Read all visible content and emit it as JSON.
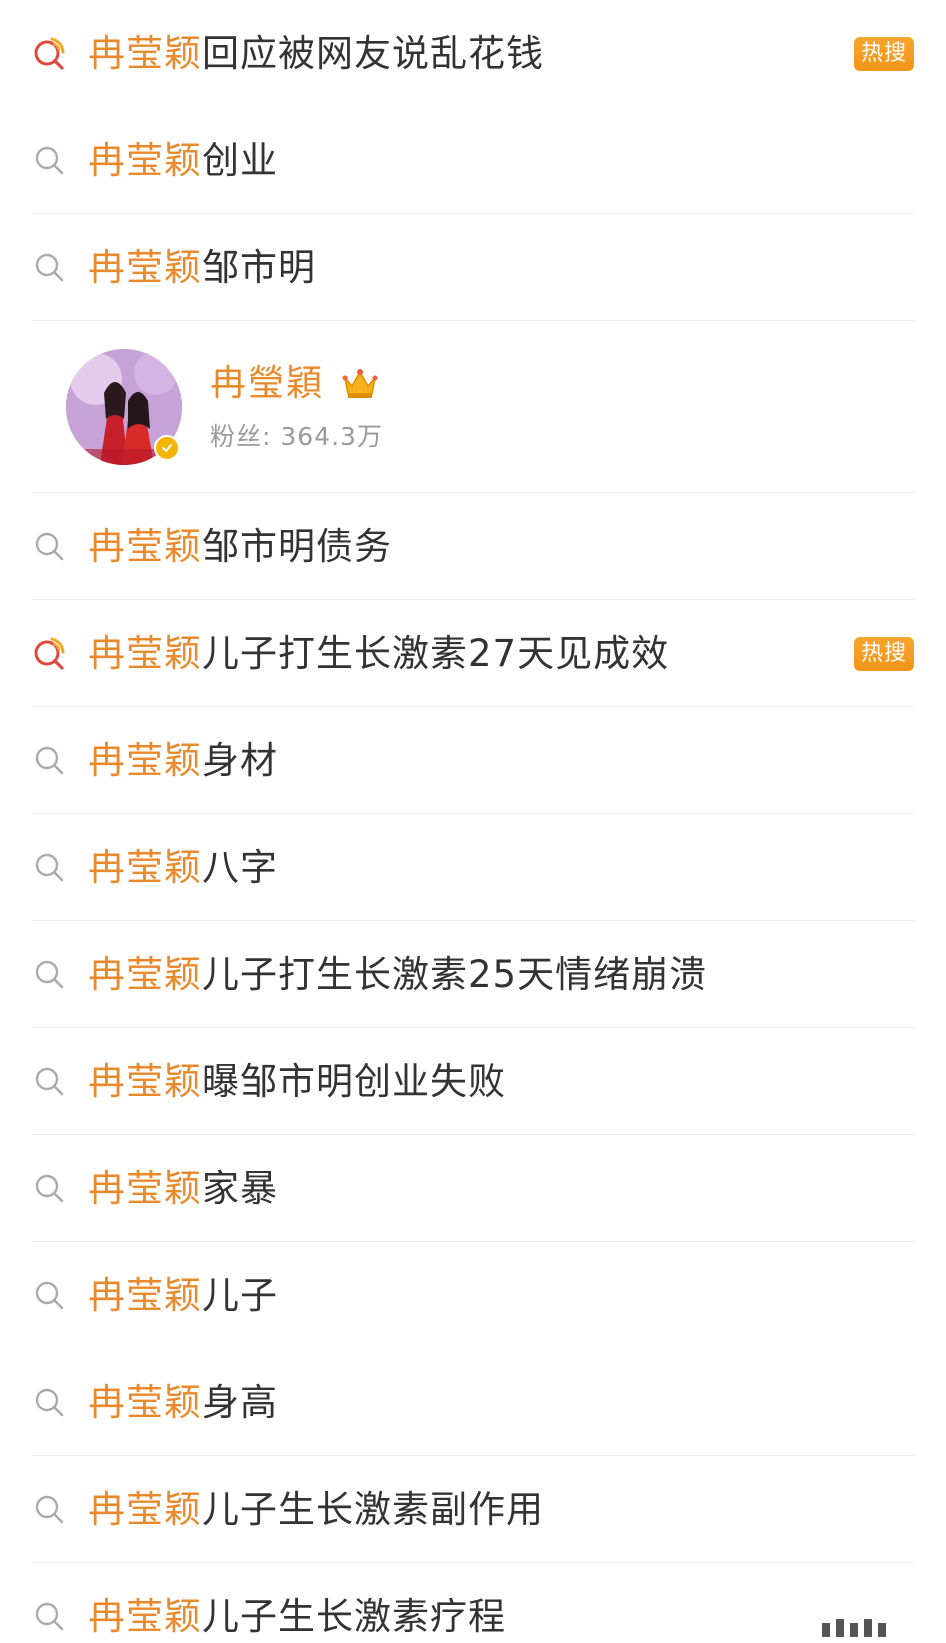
{
  "keyword": "冉莹颖",
  "hot_label": "热搜",
  "colors": {
    "keyword": "#e8892b",
    "text": "#333333",
    "hot_badge": "#f29417",
    "divider": "#ececec",
    "search_icon": "#aaaaaa",
    "hot_icon_red": "#e0483e",
    "hot_icon_orange": "#f5a623"
  },
  "rows_before_user": [
    {
      "kw": "冉莹颖",
      "rest": "回应被网友说乱花钱",
      "hot": true,
      "icon": "hot-search-icon"
    },
    {
      "kw": "冉莹颖",
      "rest": "创业",
      "hot": false,
      "icon": "search-icon"
    },
    {
      "kw": "冉莹颖",
      "rest": "邹市明",
      "hot": false,
      "icon": "search-icon"
    }
  ],
  "user": {
    "name": "冉瑩穎",
    "fans": "粉丝: 364.3万",
    "crown_icon": "crown-icon",
    "verified_icon": "verified-badge-icon"
  },
  "rows_after_user": [
    {
      "kw": "冉莹颖",
      "rest": "邹市明债务",
      "hot": false,
      "icon": "search-icon"
    },
    {
      "kw": "冉莹颖",
      "rest": "儿子打生长激素27天见成效",
      "hot": true,
      "icon": "hot-search-icon"
    },
    {
      "kw": "冉莹颖",
      "rest": "身材",
      "hot": false,
      "icon": "search-icon"
    },
    {
      "kw": "冉莹颖",
      "rest": "八字",
      "hot": false,
      "icon": "search-icon"
    },
    {
      "kw": "冉莹颖",
      "rest": "儿子打生长激素25天情绪崩溃",
      "hot": false,
      "icon": "search-icon"
    },
    {
      "kw": "冉莹颖",
      "rest": "曝邹市明创业失败",
      "hot": false,
      "icon": "search-icon"
    },
    {
      "kw": "冉莹颖",
      "rest": "家暴",
      "hot": false,
      "icon": "search-icon"
    },
    {
      "kw": "冉莹颖",
      "rest": "儿子",
      "hot": false,
      "icon": "search-icon"
    },
    {
      "kw": "冉莹颖",
      "rest": "身高",
      "hot": false,
      "icon": "search-icon"
    },
    {
      "kw": "冉莹颖",
      "rest": "儿子生长激素副作用",
      "hot": false,
      "icon": "search-icon"
    },
    {
      "kw": "冉莹颖",
      "rest": "儿子生长激素疗程",
      "hot": false,
      "icon": "search-icon"
    }
  ]
}
